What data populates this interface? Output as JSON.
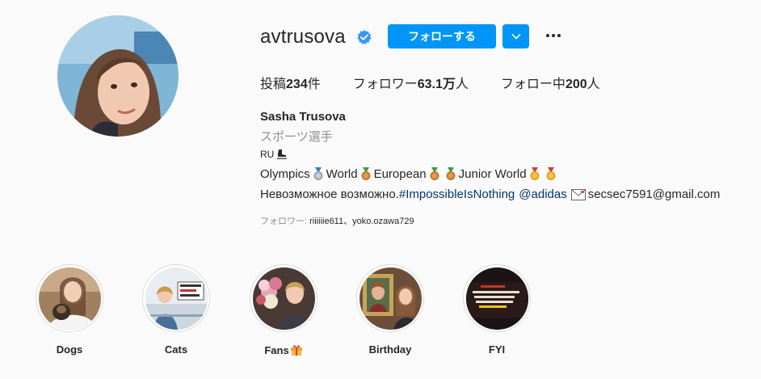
{
  "profile": {
    "username": "avtrusova",
    "follow_label": "フォローする",
    "stats": {
      "posts_label": "投稿",
      "posts_value": "234",
      "posts_unit": "件",
      "followers_label": "フォロワー",
      "followers_value": "63.1万",
      "followers_unit": "人",
      "following_label": "フォロー中",
      "following_value": "200",
      "following_unit": "人"
    },
    "full_name": "Sasha Trusova",
    "category": "スポーツ選手",
    "bio": {
      "line1": "RU",
      "line2_parts": [
        "Olympics",
        "World",
        "European",
        "Junior World"
      ],
      "line3_text": "Невозможное возможно. ",
      "hashtag": "#ImpossibleIsNothing",
      "mention": "@adidas",
      "email": "secsec7591@gmail.com"
    },
    "followed_by_label": "フォロワー: ",
    "followed_by_names": "riiiiiie611、yoko.ozawa729"
  },
  "highlights": [
    {
      "label": "Dogs"
    },
    {
      "label": "Cats"
    },
    {
      "label": "Fans"
    },
    {
      "label": "Birthday"
    },
    {
      "label": "FYI"
    }
  ],
  "colors": {
    "accent": "#0095f6",
    "link": "#00376b",
    "muted": "#8e8e8e",
    "text": "#262626",
    "background": "#fafafa"
  },
  "icons": [
    "verified-badge-icon",
    "chevron-down-icon",
    "more-options-icon",
    "skate-icon",
    "medal-icon",
    "envelope-icon",
    "gift-icon"
  ]
}
